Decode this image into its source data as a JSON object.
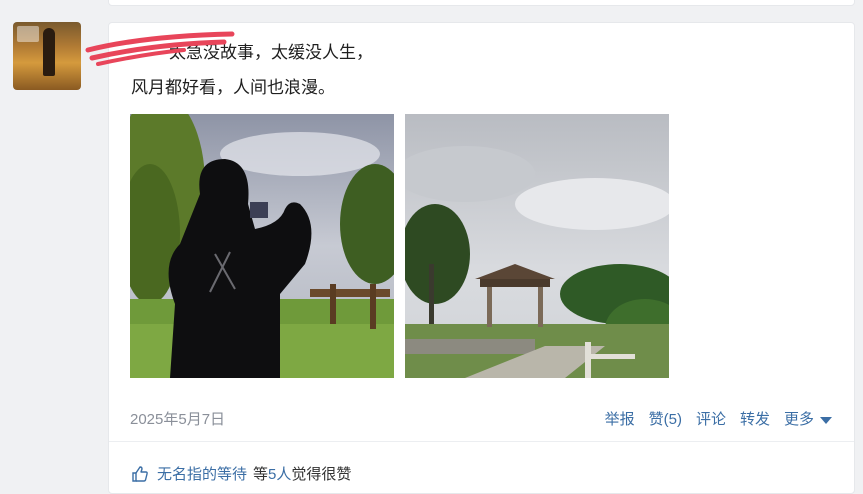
{
  "post": {
    "text_line1": "太急没故事，太缓没人生，",
    "text_line2": "风月都好看，人间也浪漫。",
    "date": "2025年5月7日"
  },
  "actions": {
    "report": "举报",
    "like": "赞(5)",
    "comment": "评论",
    "forward": "转发",
    "more": "更多"
  },
  "likes": {
    "name": "无名指的等待",
    "middle": "等",
    "count": "5人",
    "suffix": "觉得很赞"
  },
  "colors": {
    "link": "#3b6ea5",
    "date": "#8a8f99",
    "scribble": "#e8455a"
  },
  "icons": {
    "like": "thumbs-up-icon",
    "more": "triangle-down-icon"
  }
}
